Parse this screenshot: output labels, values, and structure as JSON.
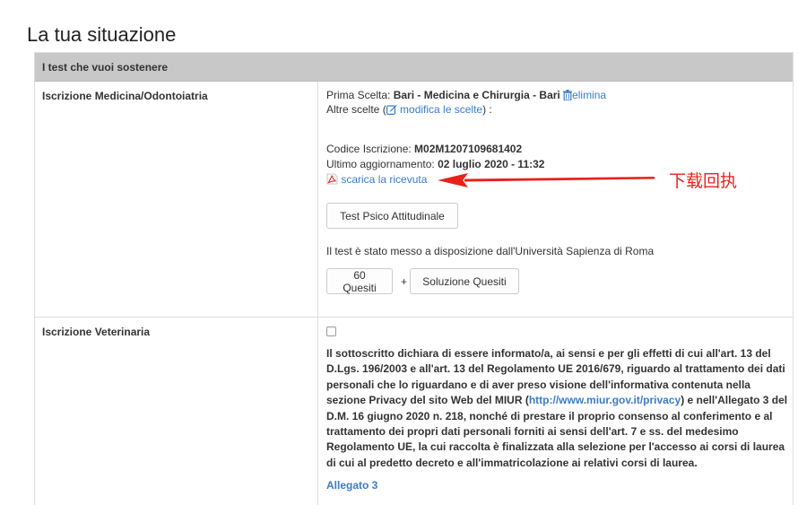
{
  "page": {
    "title": "La tua situazione"
  },
  "panel": {
    "header": "I test che vuoi sostenere",
    "rows": [
      {
        "label": "Iscrizione Medicina/Odontoiatria",
        "prima_scelta_label": "Prima Scelta: ",
        "prima_scelta_value": "Bari - Medicina e Chirurgia - Bari",
        "delete_link": "elimina",
        "altre_scelte_prefix": "Altre scelte (",
        "modify_link": "modifica le scelte",
        "altre_scelte_suffix": ") :",
        "codice_label": "Codice Iscrizione: ",
        "codice_value": "M02M1207109681402",
        "update_label": "Ultimo aggiornamento: ",
        "update_value": "02 luglio 2020 - 11:32",
        "receipt_link": "scarica la ricevuta",
        "test_button": "Test Psico Attitudinale",
        "availability_note": "Il test è stato messo a disposizione dall'Università Sapienza di Roma",
        "quesiti_button": "60 Quesiti",
        "plus": "+",
        "solution_button": "Soluzione Quesiti"
      },
      {
        "label": "Iscrizione Veterinaria",
        "consent_checked": false,
        "consent_text_before": "Il sottoscritto dichiara di essere informato/a, ai sensi e per gli effetti di cui all'art. 13 del D.Lgs. 196/2003 e all'art. 13 del Regolamento UE 2016/679, riguardo al trattamento dei dati personali che lo riguardano e di aver preso visione dell'informativa contenuta nella sezione Privacy del sito Web del MIUR (",
        "consent_link": "http://www.miur.gov.it/privacy",
        "consent_text_after": ") e nell'Allegato 3 del D.M. 16 giugno 2020 n. 218, nonché di prestare il proprio consenso al conferimento e al trattamento dei propri dati personali forniti ai sensi dell'art. 7 e ss. del medesimo Regolamento UE, la cui raccolta è finalizzata alla selezione per l'accesso ai corsi di laurea di cui al predetto decreto e all'immatricolazione ai relativi corsi di laurea.",
        "allegato_link": "Allegato 3"
      }
    ]
  },
  "annotation": {
    "text": "下载回执",
    "color": "#e8221a"
  },
  "colors": {
    "link": "#3a7dc9",
    "header_bg": "#c8c8c8",
    "border": "#dddddd",
    "pdf_icon": "#d9342b"
  },
  "icons": {
    "delete": "trash-icon",
    "modify": "edit-icon",
    "receipt": "pdf-icon"
  }
}
